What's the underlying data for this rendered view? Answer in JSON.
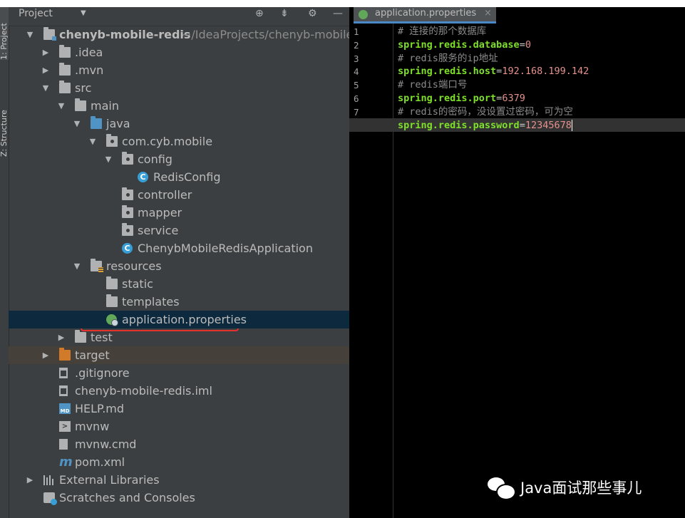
{
  "tool_stripe": {
    "tab_project": "1: Project",
    "tab_structure": "Z: Structure"
  },
  "project_panel": {
    "title": "Project",
    "icons": [
      "crosshair-icon",
      "collapse-icon",
      "gear-icon",
      "minimize-icon"
    ]
  },
  "tree": [
    {
      "label": "chenyb-mobile-redis",
      "suffix": "~/IdeaProjects/chenyb-mobile-re",
      "icon": "module-folder-icon",
      "expanded": true,
      "selected": false
    },
    {
      "label": ".idea",
      "icon": "folder-icon",
      "expanded": false
    },
    {
      "label": ".mvn",
      "icon": "folder-icon",
      "expanded": false
    },
    {
      "label": "src",
      "icon": "folder-icon",
      "expanded": true
    },
    {
      "label": "main",
      "icon": "folder-icon",
      "expanded": true
    },
    {
      "label": "java",
      "icon": "source-folder-icon",
      "expanded": true
    },
    {
      "label": "com.cyb.mobile",
      "icon": "package-icon",
      "expanded": true
    },
    {
      "label": "config",
      "icon": "package-icon",
      "expanded": true
    },
    {
      "label": "RedisConfig",
      "icon": "class-icon"
    },
    {
      "label": "controller",
      "icon": "package-icon"
    },
    {
      "label": "mapper",
      "icon": "package-icon"
    },
    {
      "label": "service",
      "icon": "package-icon"
    },
    {
      "label": "ChenybMobileRedisApplication",
      "icon": "spring-boot-class-icon"
    },
    {
      "label": "resources",
      "icon": "resources-folder-icon",
      "expanded": true
    },
    {
      "label": "static",
      "icon": "folder-icon"
    },
    {
      "label": "templates",
      "icon": "folder-icon"
    },
    {
      "label": "application.properties",
      "icon": "spring-properties-icon",
      "selected": true
    },
    {
      "label": "test",
      "icon": "folder-icon",
      "expanded": false
    },
    {
      "label": "target",
      "icon": "excluded-folder-icon",
      "expanded": false
    },
    {
      "label": ".gitignore",
      "icon": "gitignore-file-icon"
    },
    {
      "label": "chenyb-mobile-redis.iml",
      "icon": "iml-file-icon"
    },
    {
      "label": "HELP.md",
      "icon": "markdown-file-icon",
      "icon_text": "MD"
    },
    {
      "label": "mvnw",
      "icon": "shell-script-icon",
      "icon_text": ">"
    },
    {
      "label": "mvnw.cmd",
      "icon": "cmd-file-icon"
    },
    {
      "label": "pom.xml",
      "icon": "maven-pom-icon",
      "icon_text": "m"
    },
    {
      "label": "External Libraries",
      "icon": "libraries-icon",
      "expanded": false
    },
    {
      "label": "Scratches and Consoles",
      "icon": "scratches-icon"
    }
  ],
  "editor": {
    "tab_label": "application.properties",
    "tab_close": "×",
    "lines": [
      {
        "num": "1",
        "comment": "# 连接的那个数据库"
      },
      {
        "num": "2",
        "key": "spring.redis.database",
        "value": "0"
      },
      {
        "num": "3",
        "comment": "# redis服务的ip地址"
      },
      {
        "num": "4",
        "key": "spring.redis.host",
        "value": "192.168.199.142"
      },
      {
        "num": "5",
        "comment": "# redis端口号"
      },
      {
        "num": "6",
        "key": "spring.redis.port",
        "value": "6379"
      },
      {
        "num": "7",
        "comment": "# redis的密码，没设置过密码，可为空"
      },
      {
        "num": "",
        "key": "spring.redis.password",
        "value": "12345678"
      }
    ]
  },
  "watermark": {
    "text": "Java面试那些事儿"
  },
  "colors": {
    "panel_bg": "#3c3f41",
    "selected_row": "#0d293e",
    "excluded_row": "#45403a",
    "editor_bg": "#000000",
    "property_key": "#7ee02a",
    "property_value": "#e5918d",
    "comment": "#8c8c8c",
    "highlight_box": "#e5322d"
  }
}
